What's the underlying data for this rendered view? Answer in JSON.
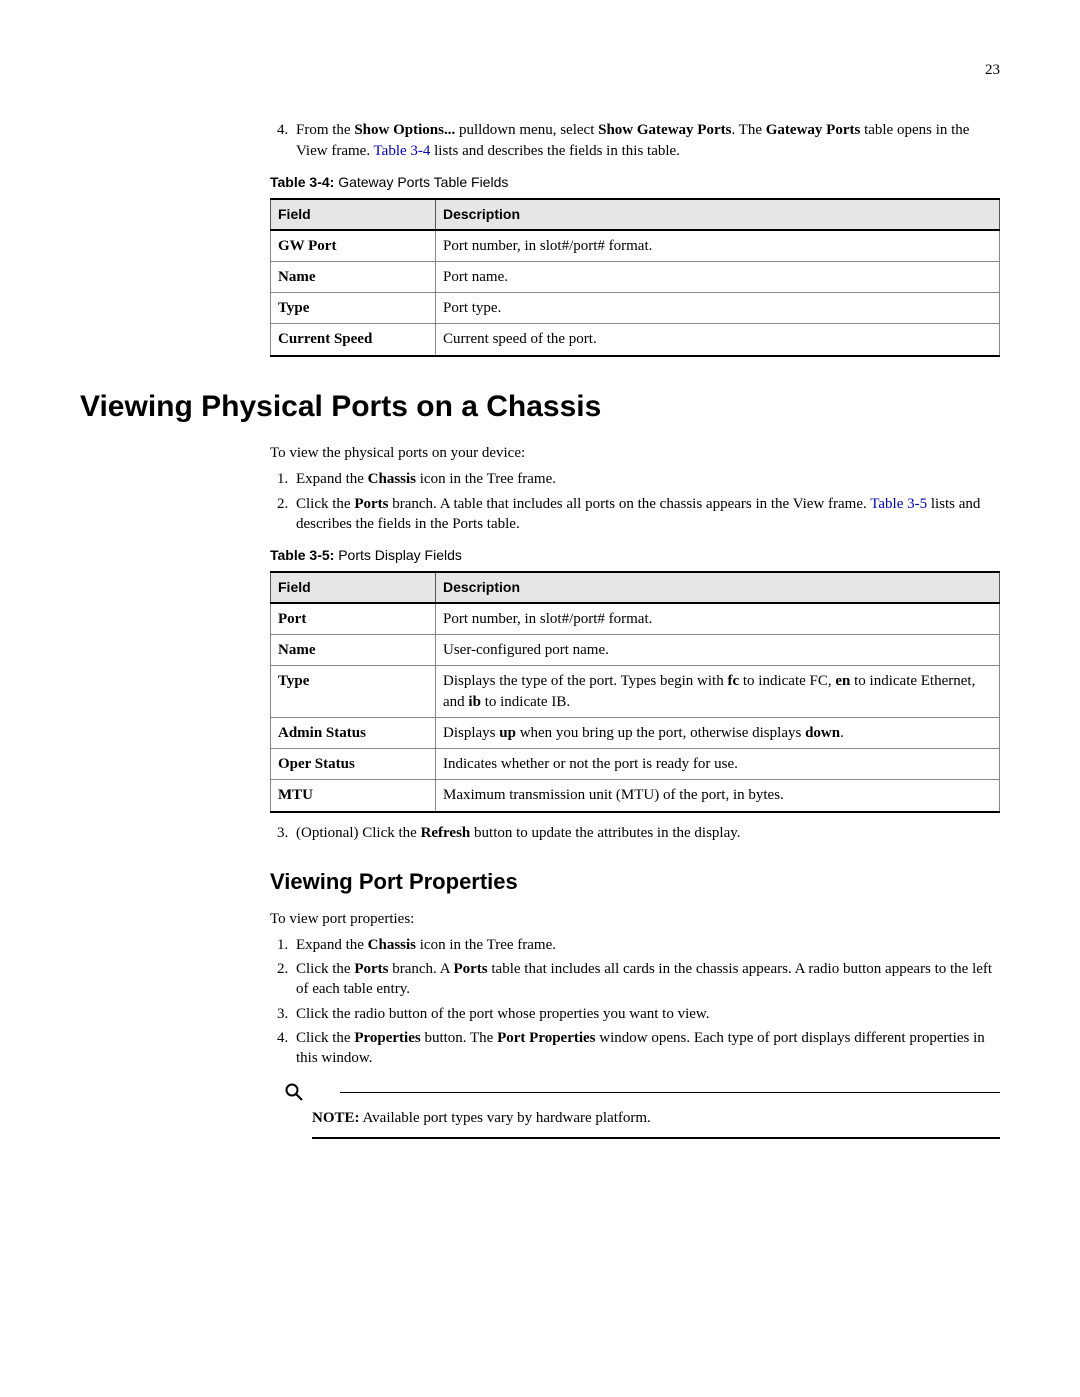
{
  "page_number": "23",
  "intro_step": {
    "pre": "From the ",
    "b1": "Show Options...",
    "mid1": " pulldown menu, select ",
    "b2": "Show Gateway Ports",
    "mid2": ". The ",
    "b3": "Gateway Ports",
    "mid3": " table opens in the View frame. ",
    "link": "Table 3-4",
    "post": " lists and describes the fields in this table."
  },
  "table34": {
    "caption_num": "Table 3-4:",
    "caption_text": " Gateway Ports Table Fields",
    "headers": {
      "c1": "Field",
      "c2": "Description"
    },
    "rows": [
      {
        "f": "GW Port",
        "d": "Port number, in slot#/port# format."
      },
      {
        "f": "Name",
        "d": "Port name."
      },
      {
        "f": "Type",
        "d": "Port type."
      },
      {
        "f": "Current Speed",
        "d": "Current speed of the port."
      }
    ]
  },
  "h1": "Viewing Physical Ports on a Chassis",
  "ports_intro": "To view the physical ports on your device:",
  "ports_steps": {
    "s1": {
      "pre": "Expand the ",
      "b1": "Chassis",
      "post": " icon in the Tree frame."
    },
    "s2": {
      "pre": "Click the ",
      "b1": "Ports",
      "mid": " branch. A table that includes all ports on the chassis appears in the View frame. ",
      "link": "Table 3-5",
      "post": " lists and describes the fields in the Ports table."
    }
  },
  "table35": {
    "caption_num": "Table 3-5:",
    "caption_text": " Ports Display Fields",
    "headers": {
      "c1": "Field",
      "c2": "Description"
    },
    "rows": {
      "r0": {
        "f": "Port",
        "d": "Port number, in slot#/port# format."
      },
      "r1": {
        "f": "Name",
        "d": "User-configured port name."
      },
      "r2": {
        "f": "Type",
        "pre": "Displays the type of the port. Types begin with ",
        "b1": "fc",
        "m1": " to indicate FC, ",
        "b2": "en",
        "m2": " to indicate Ethernet, and ",
        "b3": "ib",
        "post": " to indicate IB."
      },
      "r3": {
        "f": "Admin Status",
        "pre": "Displays ",
        "b1": "up",
        "m1": " when you bring up the port, otherwise displays ",
        "b2": "down",
        "post": "."
      },
      "r4": {
        "f": "Oper Status",
        "d": "Indicates whether or not the port is ready for use."
      },
      "r5": {
        "f": "MTU",
        "d": "Maximum transmission unit (MTU) of the port, in bytes."
      }
    }
  },
  "ports_step3": {
    "pre": "(Optional) Click the ",
    "b1": "Refresh",
    "post": " button to update the attributes in the display."
  },
  "h2": "Viewing Port Properties",
  "props_intro": "To view port properties:",
  "props_steps": {
    "s1": {
      "pre": "Expand the ",
      "b1": "Chassis",
      "post": " icon in the Tree frame."
    },
    "s2": {
      "pre": "Click the ",
      "b1": "Ports",
      "m1": " branch. A ",
      "b2": "Ports",
      "post": " table that includes all cards in the chassis appears. A radio button appears to the left of each table entry."
    },
    "s3": {
      "text": "Click the radio button of the port whose properties you want to view."
    },
    "s4": {
      "pre": "Click the ",
      "b1": "Properties",
      "m1": " button. The ",
      "b2": "Port Properties",
      "post": " window opens. Each type of port displays different properties in this window."
    }
  },
  "note": {
    "label": "NOTE:",
    "text": "  Available port types vary by hardware platform."
  }
}
